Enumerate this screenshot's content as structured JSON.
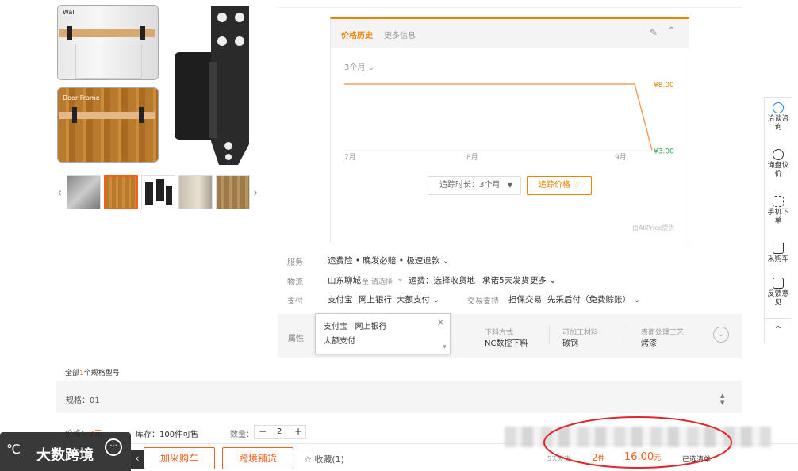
{
  "gallery": {
    "img1_label": "Wall",
    "img2_label": "Door Frame"
  },
  "price_panel": {
    "tab_active": "价格历史",
    "tab_more": "更多信息",
    "range_select": "3个月",
    "track_duration": "追踪时长：3个月",
    "track_price_button": "追踪价格",
    "footer_credit": "由AllPrice提供"
  },
  "chart_data": {
    "type": "line",
    "x": [
      "7月",
      "8月",
      "9月"
    ],
    "series": [
      {
        "values": [
          8.0,
          8.0,
          8.0,
          3.0
        ]
      }
    ],
    "high_label": "¥8.00",
    "low_label": "¥3.00",
    "colors": {
      "line": "#f5a05a",
      "high": "#f08300",
      "low": "#2aa84a"
    }
  },
  "services": {
    "service_label": "服务",
    "service_value": "运费险 • 晚发必赔 • 极速退款",
    "logistics_label": "物流",
    "logistics_from": "山东聊城",
    "logistics_to": "至 请选择",
    "freight": "运费：选择收货地",
    "promise": "承诺5天发货",
    "more": "更多",
    "pay_label": "支付",
    "pay_items": [
      "支付宝",
      "网上银行",
      "大额支付"
    ],
    "trade_label": "交易支持",
    "trade_items": [
      "担保交易",
      "先采后付（免费赊账）"
    ]
  },
  "popup": {
    "line1": "支付宝   网上银行",
    "line2": "大额支付"
  },
  "attributes": {
    "label": "属性",
    "cols": [
      {
        "name": "下料方式",
        "value": "NC数控下料"
      },
      {
        "name": "可加工材料",
        "value": "碳钢"
      },
      {
        "name": "表面处理工艺",
        "value": "烤漆"
      }
    ]
  },
  "spec": {
    "all_prefix": "全部",
    "count": "1",
    "all_suffix": "个规格型号",
    "spec_row": "规格：01",
    "price_label": "价格：",
    "price_value": "8元",
    "stock": "库存：100件可售",
    "qty_label": "数量：",
    "qty_value": "2"
  },
  "sidebar": {
    "items": [
      "洽谈咨询",
      "询盘议价",
      "手机下单",
      "采购车",
      "反馈意见"
    ]
  },
  "bottom": {
    "watermark": "大数跨境",
    "add_cart": "加采购车",
    "cross_border": "跨境铺货",
    "collect": "收藏(1)",
    "delivery": "5天发货",
    "count": "2",
    "count_unit": "件",
    "total": "16.00",
    "total_unit": "元",
    "selected": "已选清单"
  }
}
